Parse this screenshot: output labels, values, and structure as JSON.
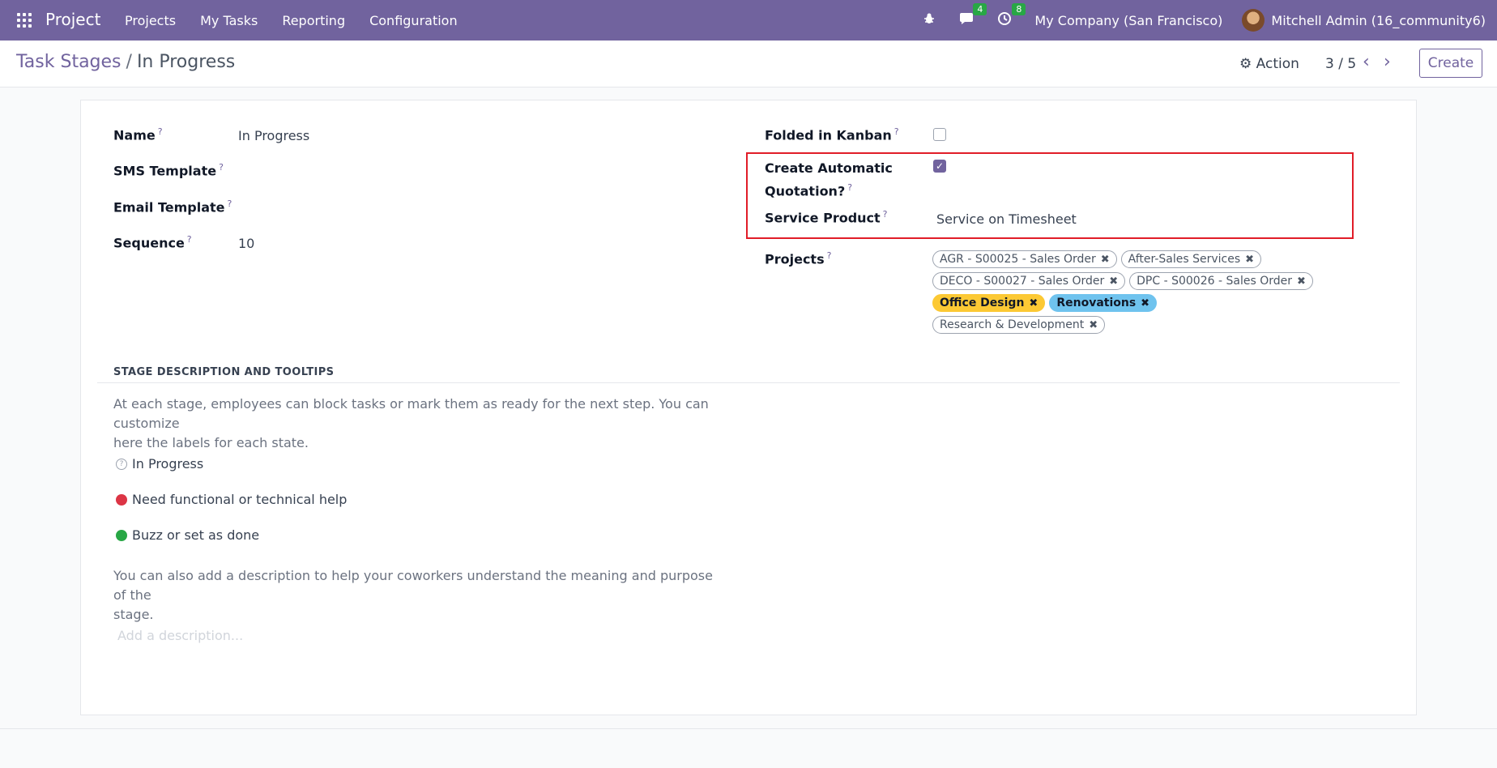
{
  "topbar": {
    "app_title": "Project",
    "menu": [
      "Projects",
      "My Tasks",
      "Reporting",
      "Configuration"
    ],
    "messages_count": "4",
    "activities_count": "8",
    "company": "My Company (San Francisco)",
    "user": "Mitchell Admin (16_community6)"
  },
  "control": {
    "breadcrumb_parent": "Task Stages",
    "breadcrumb_sep": "/",
    "breadcrumb_current": "In Progress",
    "action_label": "Action",
    "pager": "3 / 5",
    "create_label": "Create"
  },
  "form": {
    "name_label": "Name",
    "name_value": "In Progress",
    "sms_template_label": "SMS Template",
    "email_template_label": "Email Template",
    "sequence_label": "Sequence",
    "sequence_value": "10",
    "folded_label": "Folded in Kanban",
    "folded_checked": false,
    "auto_quote_label_1": "Create Automatic",
    "auto_quote_label_2": "Quotation?",
    "auto_quote_checked": true,
    "service_product_label": "Service Product",
    "service_product_value": "Service on Timesheet",
    "projects_label": "Projects",
    "help_mark": "?",
    "projects": [
      {
        "label": "AGR - S00025 - Sales Order",
        "style": "outline"
      },
      {
        "label": "After-Sales Services",
        "style": "outline"
      },
      {
        "label": "DECO - S00027 - Sales Order",
        "style": "outline"
      },
      {
        "label": "DPC - S00026 - Sales Order",
        "style": "outline"
      },
      {
        "label": "Office Design",
        "style": "yellow",
        "color": "#fcc934"
      },
      {
        "label": "Renovations",
        "style": "blue",
        "color": "#6fc3ee"
      },
      {
        "label": "Research & Development",
        "style": "outline"
      }
    ]
  },
  "stage_section": {
    "title": "STAGE DESCRIPTION AND TOOLTIPS",
    "intro_1": "At each stage, employees can block tasks or mark them as ready for the next step. You can customize",
    "intro_2": "here the labels for each state.",
    "state_normal": "In Progress",
    "state_blocked": "Need functional or technical help",
    "state_done": "Buzz or set as done",
    "footer_1": "You can also add a description to help your coworkers understand the meaning and purpose of the",
    "footer_2": "stage.",
    "description_placeholder": "Add a description..."
  },
  "colors": {
    "brand": "#71639e",
    "highlight": "#e11d28",
    "blocked": "#dc3545",
    "done": "#28a745"
  }
}
